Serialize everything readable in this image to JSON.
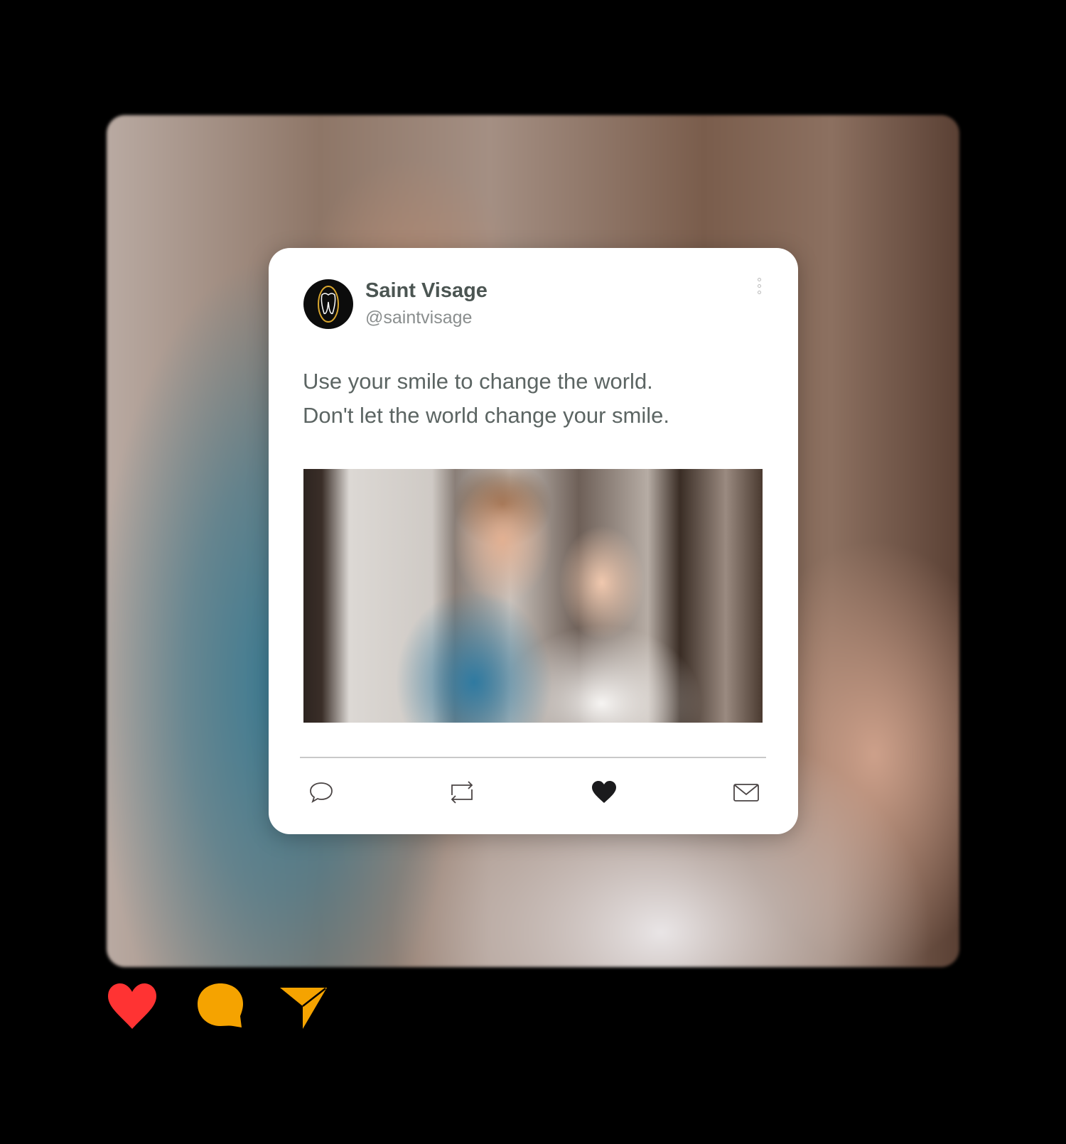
{
  "post": {
    "name": "Saint Visage",
    "handle": "@saintvisage",
    "text_line1": "Use your smile to change the world.",
    "text_line2": "Don't let the world change your smile.",
    "avatar_icon": "tooth-logo-icon",
    "more_icon": "vertical-dots-icon"
  },
  "actions": [
    "comment-icon",
    "retweet-icon",
    "heart-filled-icon",
    "mail-icon"
  ],
  "bottom_icons": {
    "like": "#ff3333",
    "comment": "#f5a300",
    "send": "#f5a300"
  }
}
